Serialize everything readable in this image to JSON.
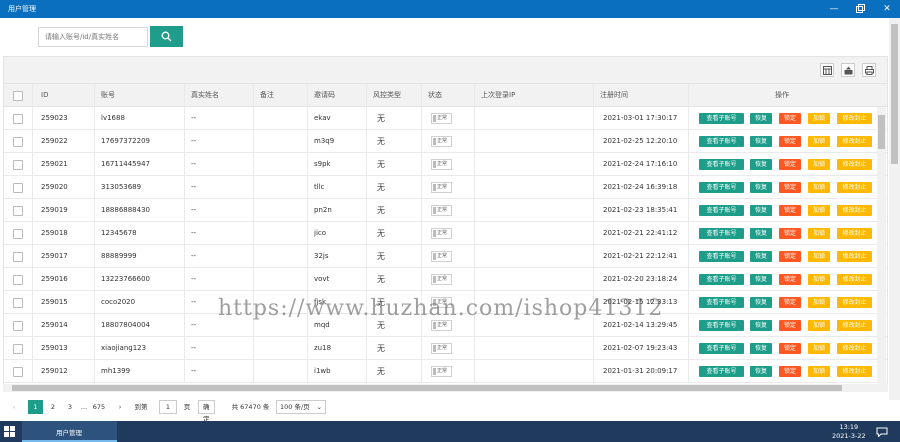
{
  "window": {
    "title": "用户管理"
  },
  "search": {
    "placeholder": "请输入账号/id/真实姓名"
  },
  "table": {
    "headers": [
      "ID",
      "账号",
      "真实姓名",
      "备注",
      "邀请码",
      "风控类型",
      "状态",
      "上次登录IP",
      "注册时间",
      "操作"
    ],
    "status_label": "正常",
    "actions": [
      "查看子账号",
      "恢复",
      "锁定",
      "加锁",
      "修改封止"
    ],
    "rows": [
      {
        "id": "259023",
        "account": "lv1688",
        "name": "--",
        "code": "ekav",
        "risk": "无",
        "time": "2021-03-01 17:30:17"
      },
      {
        "id": "259022",
        "account": "17697372209",
        "name": "--",
        "code": "m3q9",
        "risk": "无",
        "time": "2021-02-25 12:20:10"
      },
      {
        "id": "259021",
        "account": "16711445947",
        "name": "--",
        "code": "s9pk",
        "risk": "无",
        "time": "2021-02-24 17:16:10"
      },
      {
        "id": "259020",
        "account": "313053689",
        "name": "--",
        "code": "tllc",
        "risk": "无",
        "time": "2021-02-24 16:39:18"
      },
      {
        "id": "259019",
        "account": "18886888430",
        "name": "--",
        "code": "pn2n",
        "risk": "无",
        "time": "2021-02-23 18:35:41"
      },
      {
        "id": "259018",
        "account": "12345678",
        "name": "--",
        "code": "jico",
        "risk": "无",
        "time": "2021-02-21 22:41:12"
      },
      {
        "id": "259017",
        "account": "88889999",
        "name": "--",
        "code": "32js",
        "risk": "无",
        "time": "2021-02-21 22:12:41"
      },
      {
        "id": "259016",
        "account": "13223766600",
        "name": "--",
        "code": "vovt",
        "risk": "无",
        "time": "2021-02-20 23:18:24"
      },
      {
        "id": "259015",
        "account": "coco2020",
        "name": "--",
        "code": "fjsk",
        "risk": "无",
        "time": "2021-02-15 12:33:13"
      },
      {
        "id": "259014",
        "account": "18807804004",
        "name": "--",
        "code": "mqd",
        "risk": "无",
        "time": "2021-02-14 13:29:45"
      },
      {
        "id": "259013",
        "account": "xiaojiang123",
        "name": "--",
        "code": "zu18",
        "risk": "无",
        "time": "2021-02-07 19:23:43"
      },
      {
        "id": "259012",
        "account": "mh1399",
        "name": "--",
        "code": "i1wb",
        "risk": "无",
        "time": "2021-01-31 20:09:17"
      }
    ]
  },
  "pagination": {
    "pages": [
      "1",
      "2",
      "3",
      "...",
      "675"
    ],
    "goto_label": "到第",
    "page_value": "1",
    "page_unit": "页",
    "confirm": "确定",
    "total": "共 67470 条",
    "page_size": "100 条/页"
  },
  "watermark": "https://www.huzhan.com/ishop41312",
  "taskbar": {
    "task": "用户管理",
    "time": "13:19",
    "date": "2021-3-22"
  }
}
